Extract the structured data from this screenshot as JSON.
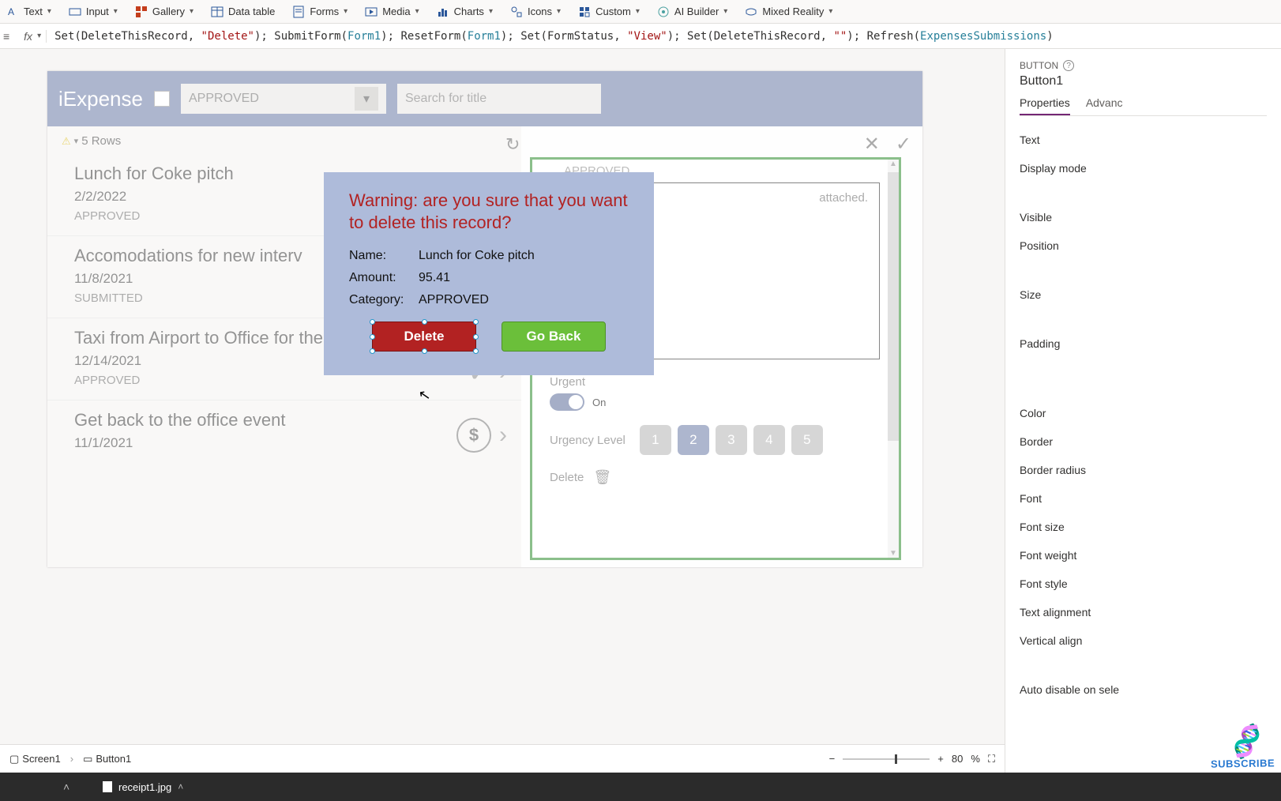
{
  "ribbon": {
    "items": [
      {
        "label": "Text",
        "icon": "text-icon"
      },
      {
        "label": "Input",
        "icon": "input-icon"
      },
      {
        "label": "Gallery",
        "icon": "gallery-icon"
      },
      {
        "label": "Data table",
        "icon": "table-icon"
      },
      {
        "label": "Forms",
        "icon": "forms-icon"
      },
      {
        "label": "Media",
        "icon": "media-icon"
      },
      {
        "label": "Charts",
        "icon": "charts-icon"
      },
      {
        "label": "Icons",
        "icon": "icons-icon"
      },
      {
        "label": "Custom",
        "icon": "custom-icon"
      },
      {
        "label": "AI Builder",
        "icon": "ai-builder-icon"
      },
      {
        "label": "Mixed Reality",
        "icon": "mixed-reality-icon"
      }
    ]
  },
  "formula": {
    "raw": "Set(DeleteThisRecord, \"Delete\"); SubmitForm(Form1); ResetForm(Form1); Set(FormStatus, \"View\"); Set(DeleteThisRecord, \"\"); Refresh(ExpensesSubmissions)"
  },
  "app": {
    "title": "iExpense",
    "filter": {
      "value": "APPROVED"
    },
    "search": {
      "placeholder": "Search for title"
    },
    "rows_header": "5 Rows",
    "items": [
      {
        "title": "Lunch for Coke pitch",
        "date": "2/2/2022",
        "status": "APPROVED"
      },
      {
        "title": "Accomodations for new interv",
        "date": "11/8/2021",
        "status": "SUBMITTED"
      },
      {
        "title": "Taxi from Airport to Office for the festival",
        "date": "12/14/2021",
        "status": "APPROVED"
      },
      {
        "title": "Get back to the office event",
        "date": "11/1/2021",
        "status": ""
      }
    ],
    "detail": {
      "status_value": "APPROVED",
      "receipt_text": "attached.",
      "urgent_label": "Urgent",
      "urgent_value": "On",
      "urgency_level_label": "Urgency Level",
      "urgency_levels": [
        "1",
        "2",
        "3",
        "4",
        "5"
      ],
      "urgency_selected": "2",
      "delete_label": "Delete"
    }
  },
  "dialog": {
    "warning": "Warning: are you sure that you want to delete this record?",
    "fields": {
      "name_label": "Name:",
      "name_value": "Lunch for Coke pitch",
      "amount_label": "Amount:",
      "amount_value": "95.41",
      "category_label": "Category:",
      "category_value": "APPROVED"
    },
    "delete_btn": "Delete",
    "goback_btn": "Go Back"
  },
  "properties": {
    "category": "BUTTON",
    "name": "Button1",
    "tabs": {
      "properties": "Properties",
      "advanced": "Advanc"
    },
    "rows": [
      "Text",
      "Display mode",
      "",
      "Visible",
      "Position",
      "",
      "Size",
      "",
      "Padding",
      "",
      "",
      "Color",
      "Border",
      "Border radius",
      "Font",
      "Font size",
      "Font weight",
      "Font style",
      "Text alignment",
      "Vertical align",
      "",
      "Auto disable on sele"
    ]
  },
  "statusbar": {
    "breadcrumbs": [
      {
        "icon": "screen-icon",
        "label": "Screen1"
      },
      {
        "icon": "button-icon",
        "label": "Button1"
      }
    ],
    "zoom_value": "80",
    "zoom_suffix": "%"
  },
  "taskbar": {
    "file": "receipt1.jpg"
  },
  "watermark": "SUBSCRIBE"
}
